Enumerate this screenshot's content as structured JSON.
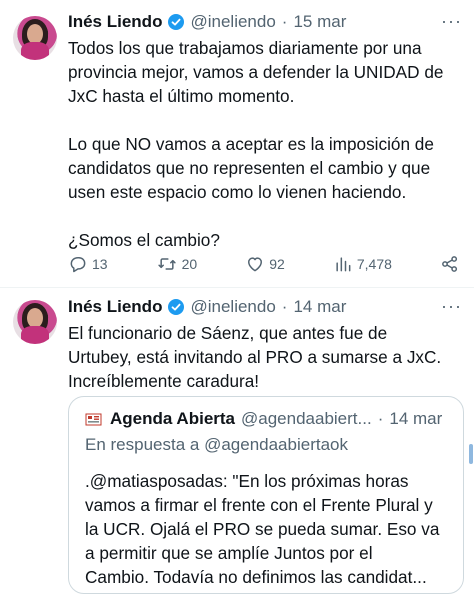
{
  "tweets": [
    {
      "name": "Inés Liendo",
      "handle": "@ineliendo",
      "separator": "·",
      "date": "15 mar",
      "text": "Todos los que trabajamos diariamente por una\nprovincia mejor, vamos a defender la UNIDAD de\nJxC hasta el último momento.\n\nLo que NO vamos a aceptar es la imposición de\ncandidatos que no representen el cambio y que\nusen este espacio como lo vienen haciendo.\n\n¿Somos el cambio?",
      "replies": "13",
      "retweets": "20",
      "likes": "92",
      "views": "7,478"
    },
    {
      "name": "Inés Liendo",
      "handle": "@ineliendo",
      "separator": "·",
      "date": "14 mar",
      "text": "El funcionario de Sáenz, que antes fue de\nUrtubey, está invitando al PRO a sumarse a JxC.\nIncreíblemente caradura!",
      "quote": {
        "name": "Agenda Abierta",
        "handle": "@agendaabiert...",
        "separator": "·",
        "date": "14 mar",
        "reply_to": "En respuesta a @agendaabiertaok",
        "text": ".@matiasposadas: \"En los próximas horas\nvamos a firmar el frente con el Frente Plural y\nla UCR. Ojalá el PRO se pueda sumar. Eso va\na permitir que se amplíe Juntos por el\nCambio. Todavía no definimos las candidat..."
      }
    }
  ],
  "more_label": "···",
  "colors": {
    "accent": "#1d9bf0",
    "secondary_text": "#536471",
    "border": "#cfd9de"
  }
}
